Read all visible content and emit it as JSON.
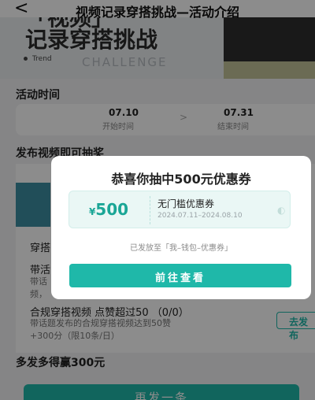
{
  "nav": {
    "back_icon": "back-arrow-icon",
    "back_glyph": "<",
    "title": "视频记录穿搭挑战—活动介绍"
  },
  "banner": {
    "top_line": "「视频」",
    "headline": "记录穿搭挑战",
    "trend": "Trend",
    "challenge": "CHALLENGE"
  },
  "activity_time": {
    "title": "活动时间",
    "start_date": "07.10",
    "start_label": "开始时间",
    "separator": ">",
    "end_date": "07.31",
    "end_label": "结束时间"
  },
  "lottery": {
    "title": "发布视频即可抽奖"
  },
  "tasks": [
    {
      "title": "穿搭",
      "desc": ""
    },
    {
      "title": "带活",
      "desc": "带话\n频，"
    },
    {
      "title": "合规穿搭视频 点赞超过50 （0/0）",
      "desc": "带话题发布的合规穿搭视频达到50赞\n+300分（限10条/日）",
      "action": "去发布"
    }
  ],
  "more": {
    "title": "多发多得赢300元"
  },
  "bottom_button": "再发一条",
  "modal": {
    "title": "恭喜你抽中500元优惠券",
    "coupon": {
      "currency": "¥",
      "amount": "500",
      "name": "无门槛优惠券",
      "period": "2024.07.11–2024.08.10"
    },
    "issued_note": "已发放至「我–钱包–优惠券」",
    "button": "前往查看"
  },
  "colors": {
    "accent": "#1fb8a9",
    "coupon_bg": "#eaf7f5",
    "overlay": "rgba(0,0,0,0.45)"
  }
}
